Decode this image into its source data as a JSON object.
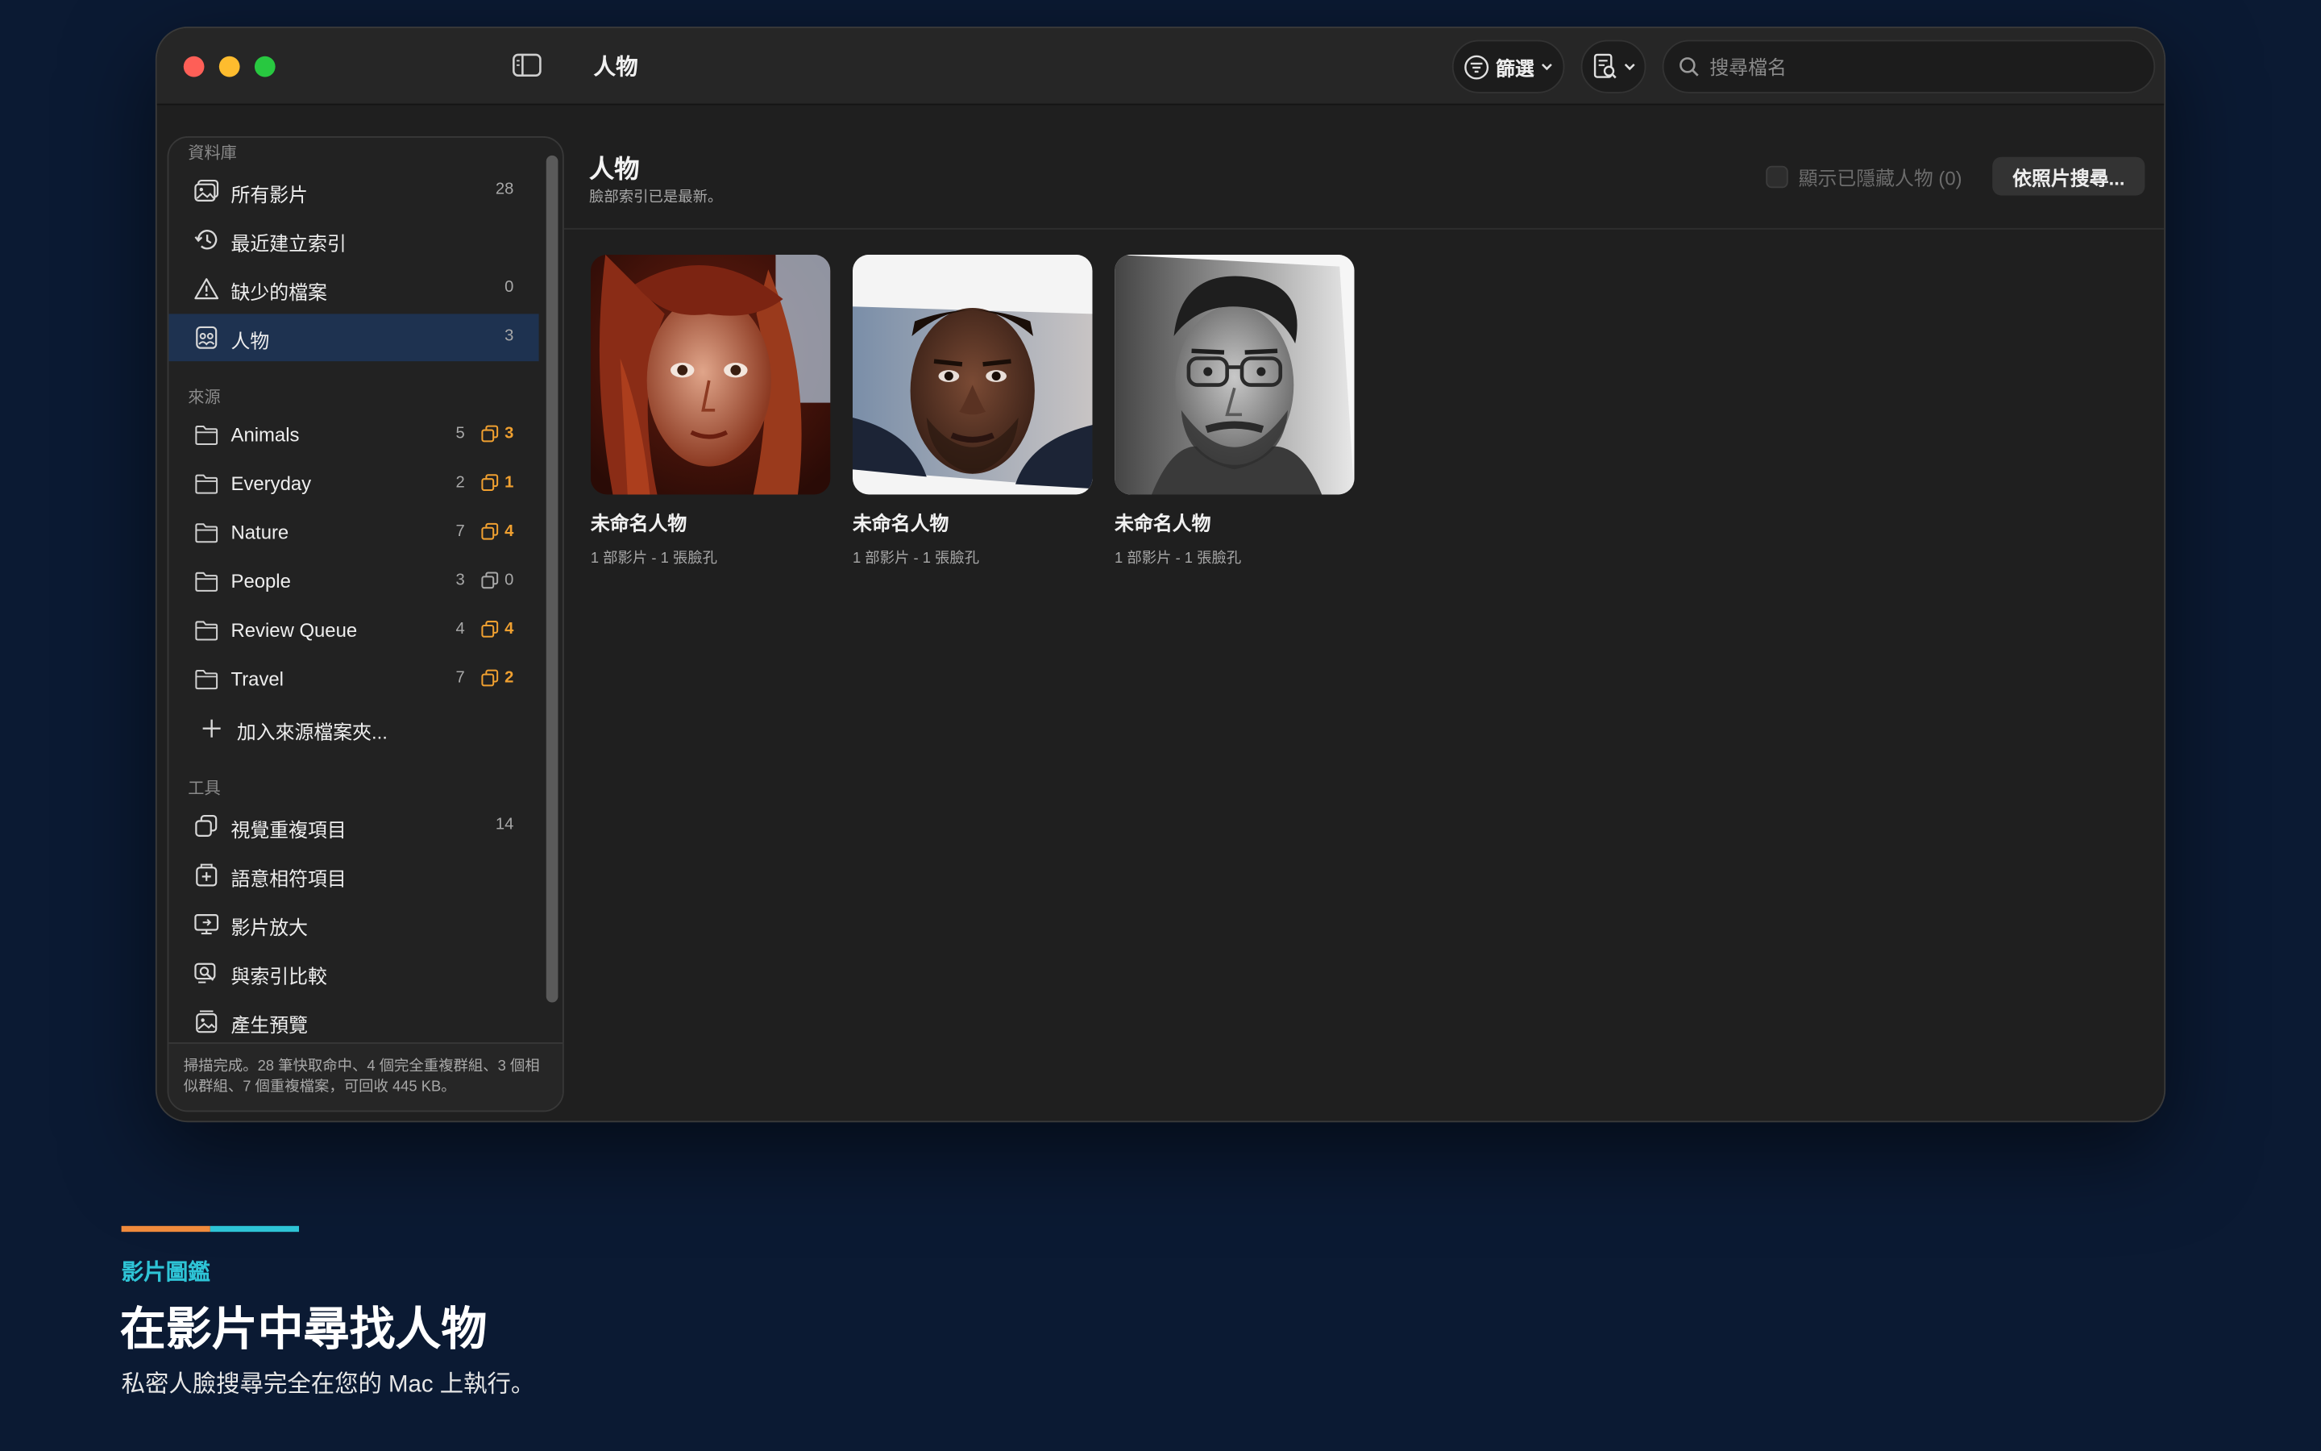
{
  "window": {
    "title": "人物",
    "filter_label": "篩選",
    "search_placeholder": "搜尋檔名"
  },
  "sidebar": {
    "library_header": "資料庫",
    "library": [
      {
        "label": "所有影片",
        "count": "28",
        "icon": "photo-library-icon"
      },
      {
        "label": "最近建立索引",
        "count": "",
        "icon": "history-icon"
      },
      {
        "label": "缺少的檔案",
        "count": "0",
        "icon": "warning-icon"
      },
      {
        "label": "人物",
        "count": "3",
        "icon": "people-icon",
        "active": true
      }
    ],
    "sources_header": "來源",
    "sources": [
      {
        "label": "Animals",
        "count": "5",
        "dup": "3"
      },
      {
        "label": "Everyday",
        "count": "2",
        "dup": "1"
      },
      {
        "label": "Nature",
        "count": "7",
        "dup": "4"
      },
      {
        "label": "People",
        "count": "3",
        "dup": "0"
      },
      {
        "label": "Review Queue",
        "count": "4",
        "dup": "4"
      },
      {
        "label": "Travel",
        "count": "7",
        "dup": "2"
      }
    ],
    "add_source": "加入來源檔案夾...",
    "tools_header": "工具",
    "tools": [
      {
        "label": "視覺重複項目",
        "count": "14",
        "icon": "duplicates-icon"
      },
      {
        "label": "語意相符項目",
        "count": "",
        "icon": "semantic-match-icon"
      },
      {
        "label": "影片放大",
        "count": "",
        "icon": "upscale-icon"
      },
      {
        "label": "與索引比較",
        "count": "",
        "icon": "compare-icon"
      },
      {
        "label": "產生預覽",
        "count": "",
        "icon": "preview-icon"
      }
    ],
    "footer": "掃描完成。28 筆快取命中、4 個完全重複群組、3 個相似群組、7 個重複檔案，可回收 445 KB。"
  },
  "main": {
    "title": "人物",
    "subtitle": "臉部索引已是最新。",
    "show_hidden": "顯示已隱藏人物 (0)",
    "search_by_photo": "依照片搜尋...",
    "people": [
      {
        "name": "未命名人物",
        "meta": "1 部影片 - 1 張臉孔"
      },
      {
        "name": "未命名人物",
        "meta": "1 部影片 - 1 張臉孔"
      },
      {
        "name": "未命名人物",
        "meta": "1 部影片 - 1 張臉孔"
      }
    ]
  },
  "caption": {
    "tag": "影片圖鑑",
    "title": "在影片中尋找人物",
    "subtitle": "私密人臉搜尋完全在您的 Mac 上執行。"
  },
  "colors": {
    "background": "#0b1a33",
    "accent_orange": "#f08a3c",
    "accent_cyan": "#2ec4d6",
    "dup_badge": "#f0a030",
    "sidebar_active": "#1e3250"
  }
}
